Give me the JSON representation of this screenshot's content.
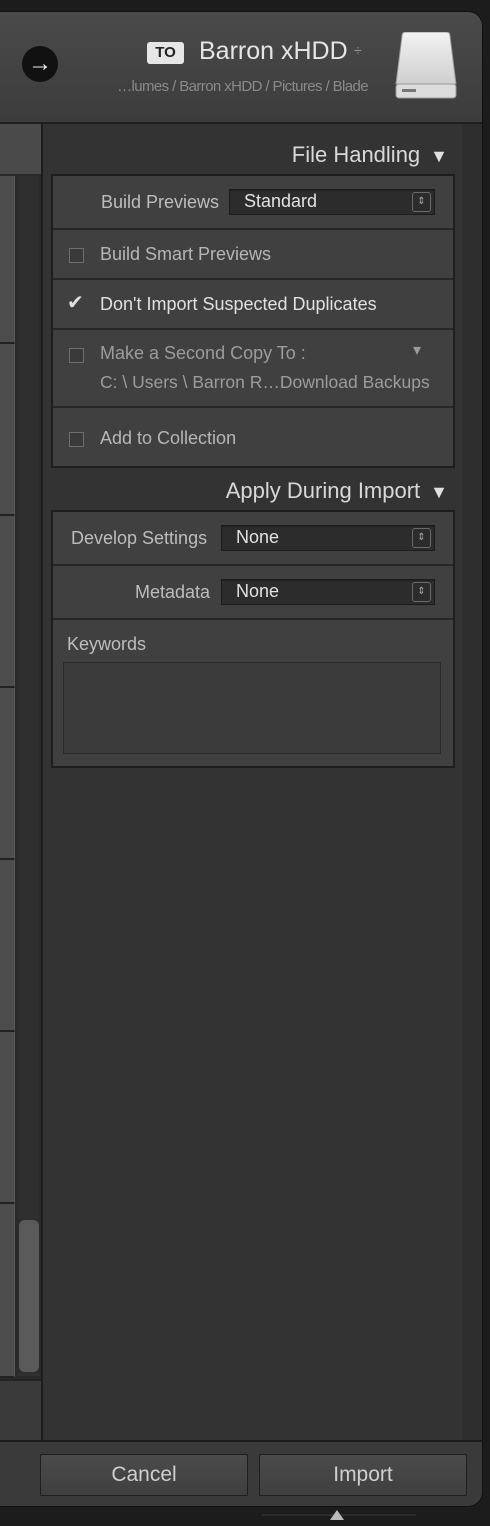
{
  "header": {
    "to_badge": "TO",
    "destination_name": "Barron xHDD",
    "destination_chevron": "÷",
    "destination_path": "…lumes / Barron xHDD / Pictures / Blade",
    "go_icon": "→"
  },
  "file_handling": {
    "title": "File Handling",
    "toggle": "▼",
    "build_previews_label": "Build Previews",
    "build_previews_value": "Standard",
    "build_smart_previews_label": "Build Smart Previews",
    "build_smart_previews_checked": false,
    "dont_import_dupes_label": "Don't Import Suspected Duplicates",
    "dont_import_dupes_checked": true,
    "second_copy_label": "Make a Second Copy To :",
    "second_copy_path": "C: \\ Users \\ Barron R…Download Backups",
    "second_copy_dropdown": "▾",
    "add_to_collection_label": "Add to Collection"
  },
  "apply_during_import": {
    "title": "Apply During Import",
    "toggle": "▼",
    "develop_settings_label": "Develop Settings",
    "develop_settings_value": "None",
    "metadata_label": "Metadata",
    "metadata_value": "None",
    "keywords_label": "Keywords",
    "keywords_value": ""
  },
  "footer": {
    "cancel_label": "Cancel",
    "import_label": "Import"
  },
  "colors": {
    "panel_bg": "#333333",
    "section_box_bg": "#404040",
    "text": "#c9c9c9"
  }
}
